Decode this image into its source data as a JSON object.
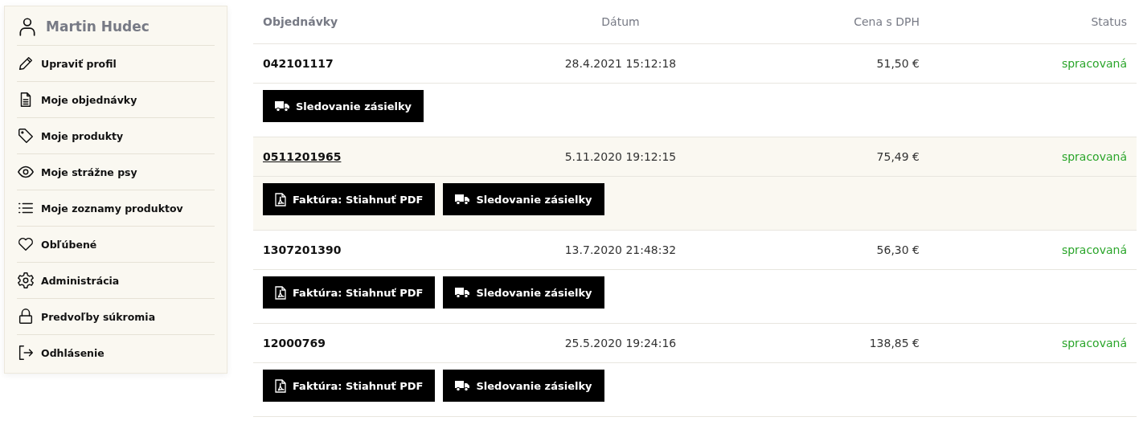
{
  "sidebar": {
    "user_name": "Martin Hudec",
    "items": [
      {
        "label": "Upraviť profil"
      },
      {
        "label": "Moje objednávky"
      },
      {
        "label": "Moje produkty"
      },
      {
        "label": "Moje strážne psy"
      },
      {
        "label": "Moje zoznamy produktov"
      },
      {
        "label": "Obľúbené"
      },
      {
        "label": "Administrácia"
      },
      {
        "label": "Predvoľby súkromia"
      },
      {
        "label": "Odhlásenie"
      }
    ]
  },
  "orders": {
    "columns": [
      "Objednávky",
      "Dátum",
      "Cena s DPH",
      "Status"
    ],
    "rows": [
      {
        "number": "042101117",
        "date": "28.4.2021 15:12:18",
        "price": "51,50 €",
        "status": "spracovaná",
        "selected": false,
        "buttons": [
          {
            "kind": "tracking",
            "label": "Sledovanie zásielky"
          }
        ]
      },
      {
        "number": "0511201965",
        "date": "5.11.2020 19:12:15",
        "price": "75,49 €",
        "status": "spracovaná",
        "selected": true,
        "buttons": [
          {
            "kind": "invoice",
            "label": "Faktúra: Stiahnuť PDF"
          },
          {
            "kind": "tracking",
            "label": "Sledovanie zásielky"
          }
        ]
      },
      {
        "number": "1307201390",
        "date": "13.7.2020 21:48:32",
        "price": "56,30 €",
        "status": "spracovaná",
        "selected": false,
        "buttons": [
          {
            "kind": "invoice",
            "label": "Faktúra: Stiahnuť PDF"
          },
          {
            "kind": "tracking",
            "label": "Sledovanie zásielky"
          }
        ]
      },
      {
        "number": "12000769",
        "date": "25.5.2020 19:24:16",
        "price": "138,85 €",
        "status": "spracovaná",
        "selected": false,
        "buttons": [
          {
            "kind": "invoice",
            "label": "Faktúra: Stiahnuť PDF"
          },
          {
            "kind": "tracking",
            "label": "Sledovanie zásielky"
          }
        ]
      }
    ]
  }
}
